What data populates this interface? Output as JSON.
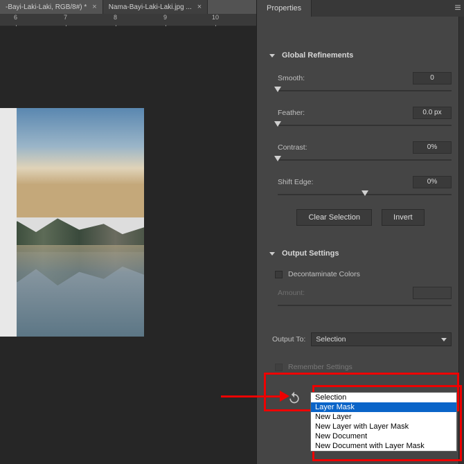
{
  "tabs": [
    {
      "label": "-Bayi-Laki-Laki, RGB/8#) *",
      "close": "×"
    },
    {
      "label": "Nama-Bayi-Laki-Laki.jpg ...",
      "close": "×"
    }
  ],
  "ruler": [
    "6",
    "7",
    "8",
    "9",
    "10"
  ],
  "panel": {
    "title": "Properties",
    "global": {
      "header": "Global Refinements",
      "smooth_label": "Smooth:",
      "smooth_val": "0",
      "feather_label": "Feather:",
      "feather_val": "0.0 px",
      "contrast_label": "Contrast:",
      "contrast_val": "0%",
      "shift_label": "Shift Edge:",
      "shift_val": "0%",
      "clear_btn": "Clear Selection",
      "invert_btn": "Invert"
    },
    "output": {
      "header": "Output Settings",
      "decon_label": "Decontaminate Colors",
      "amount_label": "Amount:",
      "amount_val": "",
      "out_label": "Output To:",
      "out_selected": "Selection",
      "remember_label": "Remember Settings",
      "options": [
        "Selection",
        "Layer Mask",
        "New Layer",
        "New Layer with Layer Mask",
        "New Document",
        "New Document with Layer Mask"
      ]
    }
  }
}
